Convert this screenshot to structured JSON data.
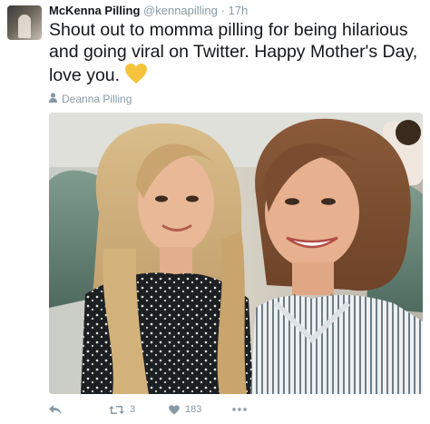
{
  "author": {
    "name": "McKenna Pilling",
    "handle": "@kennapilling",
    "separator": "·",
    "time": "17h"
  },
  "tweet": {
    "text": "Shout out to momma pilling for being hilarious and going viral on Twitter. Happy Mother's Day, love you.",
    "emoji_icon": "yellow-heart-icon"
  },
  "photo": {
    "tagged_user": "Deanna Pilling",
    "tag_icon": "person-icon"
  },
  "actions": {
    "reply_icon": "reply-icon",
    "retweet_icon": "retweet-icon",
    "retweet_count": "3",
    "like_icon": "heart-icon",
    "like_count": "183",
    "more_icon": "more-dots-icon"
  },
  "colors": {
    "text": "#14171a",
    "muted": "#8899a6",
    "emoji_heart": "#f5c33b"
  }
}
